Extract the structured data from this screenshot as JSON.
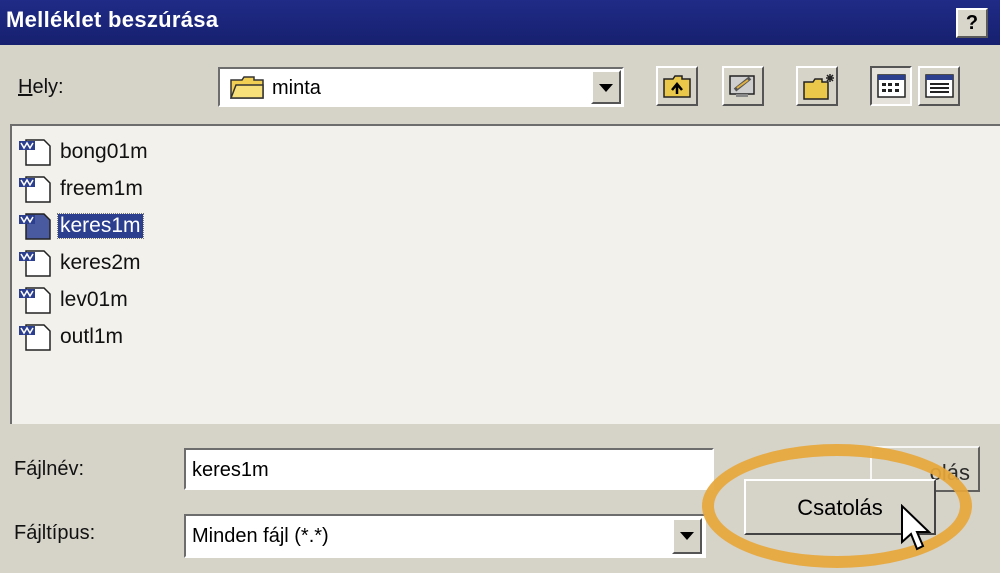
{
  "window": {
    "title": "Melléklet beszúrása",
    "help_label": "?"
  },
  "location": {
    "label": "Hely:",
    "value": "minta"
  },
  "toolbar": [
    {
      "name": "up-one-level-button",
      "icon": "folder-up-icon"
    },
    {
      "name": "desktop-button",
      "icon": "desktop-icon"
    },
    {
      "name": "new-folder-button",
      "icon": "new-folder-icon"
    },
    {
      "name": "list-view-button",
      "icon": "list-view-icon"
    },
    {
      "name": "details-view-button",
      "icon": "details-view-icon"
    }
  ],
  "files": [
    {
      "name": "bong01m",
      "selected": false
    },
    {
      "name": "freem1m",
      "selected": false
    },
    {
      "name": "keres1m",
      "selected": true
    },
    {
      "name": "keres2m",
      "selected": false
    },
    {
      "name": "lev01m",
      "selected": false
    },
    {
      "name": "outl1m",
      "selected": false
    }
  ],
  "filename": {
    "label": "Fájlnév:",
    "value": "keres1m"
  },
  "filetype": {
    "label": "Fájltípus:",
    "value": "Minden fájl (*.*)"
  },
  "buttons": {
    "attach": "Csatolás",
    "attach_ghost": "olás"
  },
  "colors": {
    "titlebar": "#1f2b86",
    "selection": "#2c3f8f",
    "highlight_ring": "#e7a73a"
  }
}
